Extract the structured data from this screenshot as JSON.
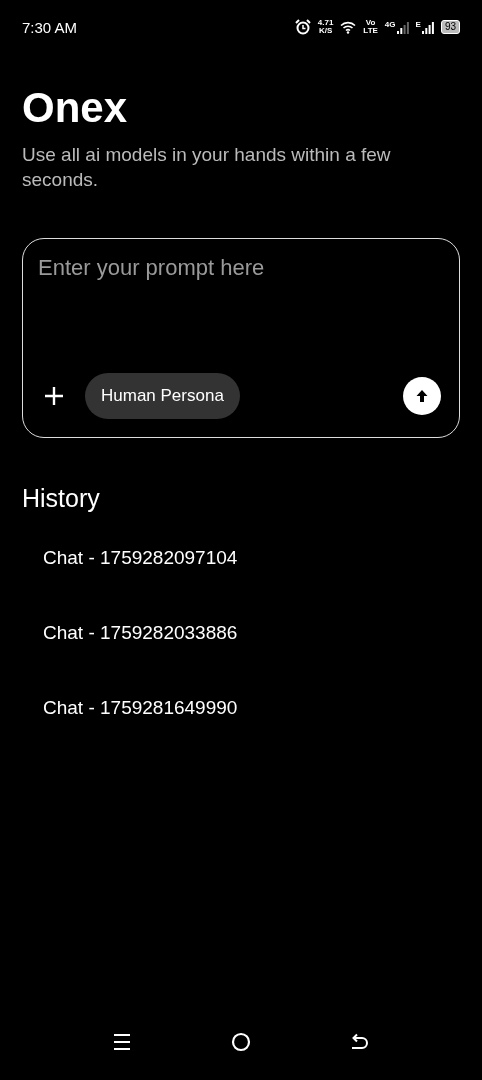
{
  "status_bar": {
    "time": "7:30 AM",
    "speed": "4.71",
    "speed_unit": "K/S",
    "volte_top": "Vo",
    "volte_bottom": "LTE",
    "network_1": "4G",
    "network_2": "E",
    "battery": "93"
  },
  "app": {
    "title": "Onex",
    "subtitle": "Use all ai models in your hands within a few seconds."
  },
  "prompt": {
    "placeholder": "Enter your prompt here",
    "chip": "Human Persona"
  },
  "history": {
    "title": "History",
    "items": [
      {
        "label": "Chat - 1759282097104"
      },
      {
        "label": "Chat - 1759282033886"
      },
      {
        "label": "Chat - 1759281649990"
      }
    ]
  }
}
